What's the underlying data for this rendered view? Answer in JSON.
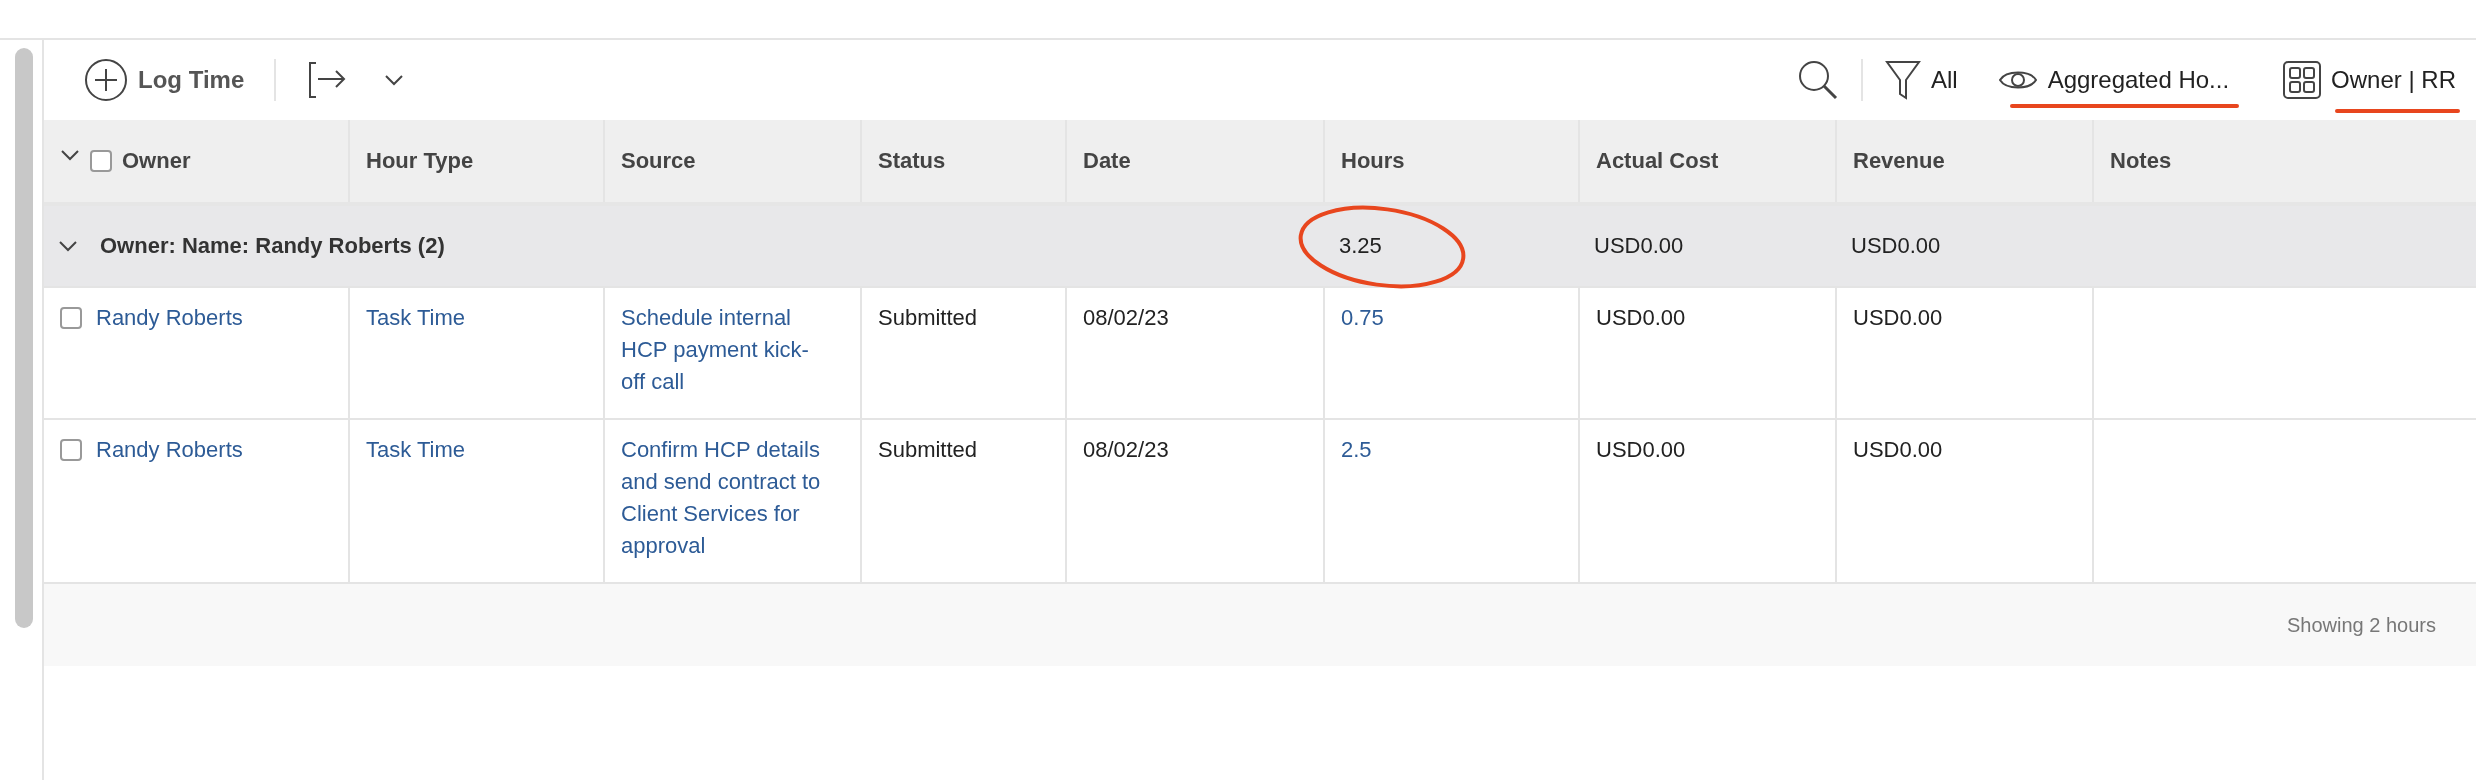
{
  "toolbar": {
    "log_time": "Log Time",
    "filter": "All",
    "view": "Aggregated Ho...",
    "grouping": "Owner | RR"
  },
  "table": {
    "select_all": {
      "checked": false
    },
    "columns": [
      "Owner",
      "Hour Type",
      "Source",
      "Status",
      "Date",
      "Hours",
      "Actual Cost",
      "Revenue",
      "Notes"
    ],
    "groups": [
      {
        "label": "Owner: Name: Randy Roberts (2)",
        "expanded": true,
        "hours": "3.25",
        "actual_cost": "USD0.00",
        "revenue": "USD0.00",
        "rows": [
          {
            "checked": false,
            "owner": "Randy Roberts",
            "hour_type": "Task Time",
            "source": "Schedule internal HCP payment kick-off call",
            "status": "Submitted",
            "date": "08/02/23",
            "hours": "0.75",
            "actual_cost": "USD0.00",
            "revenue": "USD0.00"
          },
          {
            "checked": false,
            "owner": "Randy Roberts",
            "hour_type": "Task Time",
            "source": "Confirm HCP details and send contract to Client Services for approval",
            "status": "Submitted",
            "date": "08/02/23",
            "hours": "2.5",
            "actual_cost": "USD0.00",
            "revenue": "USD0.00"
          }
        ]
      }
    ]
  },
  "footer": "Showing 2 hours"
}
